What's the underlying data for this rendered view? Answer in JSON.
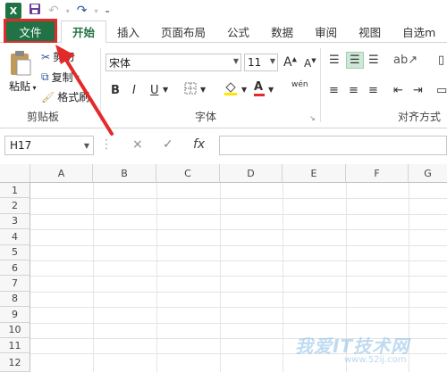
{
  "quick_access": {
    "app_icon": "X",
    "icons": [
      "excel-icon",
      "save-icon",
      "undo-icon",
      "redo-icon",
      "customize-icon"
    ]
  },
  "tabs": [
    {
      "label": "文件"
    },
    {
      "label": "开始"
    },
    {
      "label": "插入"
    },
    {
      "label": "页面布局"
    },
    {
      "label": "公式"
    },
    {
      "label": "数据"
    },
    {
      "label": "审阅"
    },
    {
      "label": "视图"
    },
    {
      "label": "自选m"
    }
  ],
  "clipboard": {
    "paste": "粘贴",
    "cut": "剪切",
    "copy": "复制",
    "format_painter": "格式刷",
    "group": "剪贴板"
  },
  "font": {
    "name": "宋体",
    "size": "11",
    "bold": "B",
    "italic": "I",
    "underline": "U",
    "grow": "A",
    "shrink": "A",
    "phonetic": "wén",
    "group": "字体"
  },
  "alignment": {
    "group": "对齐方式"
  },
  "formula_bar": {
    "name_box": "H17",
    "cancel": "×",
    "enter": "✓",
    "fx": "fx",
    "value": ""
  },
  "columns": [
    "A",
    "B",
    "C",
    "D",
    "E",
    "F",
    "G"
  ],
  "rows": [
    "1",
    "2",
    "3",
    "4",
    "5",
    "6",
    "7",
    "8",
    "9",
    "10",
    "11",
    "12"
  ],
  "watermark": {
    "text": "我爱IT技术网",
    "url": "www.52ij.com"
  },
  "colors": {
    "accent": "#217346",
    "highlight": "#e32a2a"
  }
}
